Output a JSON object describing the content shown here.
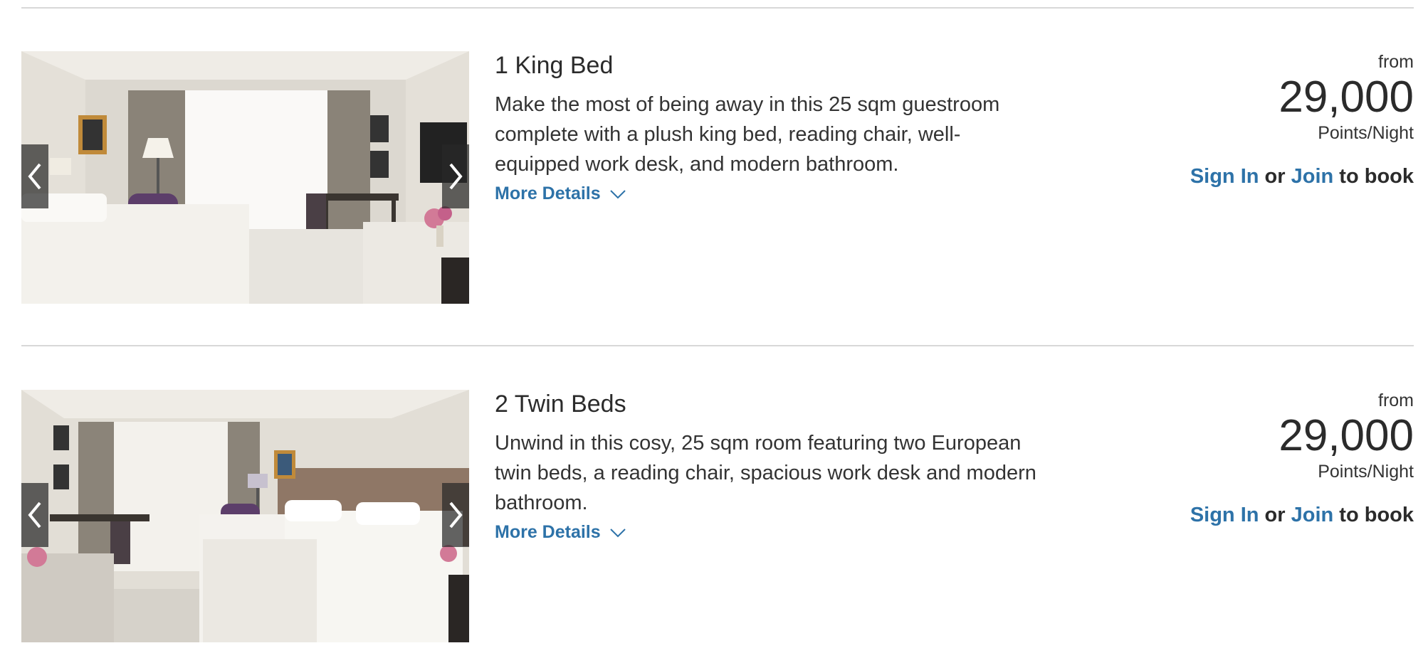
{
  "rooms": [
    {
      "title": "1 King Bed",
      "description": "Make the most of being away in this 25 sqm guestroom complete with a plush king bed, reading chair, well-equipped work desk, and modern bathroom.",
      "more_details": "More Details",
      "from_label": "from",
      "price": "29,000",
      "price_unit": "Points/Night",
      "sign_in": "Sign In",
      "or": "or",
      "join": "Join",
      "to_book": "to book"
    },
    {
      "title": "2 Twin Beds",
      "description": "Unwind in this cosy, 25 sqm room featuring two European twin beds, a reading chair, spacious work desk and modern bathroom.",
      "more_details": "More Details",
      "from_label": "from",
      "price": "29,000",
      "price_unit": "Points/Night",
      "sign_in": "Sign In",
      "or": "or",
      "join": "Join",
      "to_book": "to book"
    }
  ],
  "colors": {
    "link": "#2d72a8",
    "text": "#2b2b2b",
    "divider": "#d8d8d8"
  },
  "icons": {
    "prev": "chevron-left-icon",
    "next": "chevron-right-icon",
    "expand": "chevron-down-icon"
  }
}
